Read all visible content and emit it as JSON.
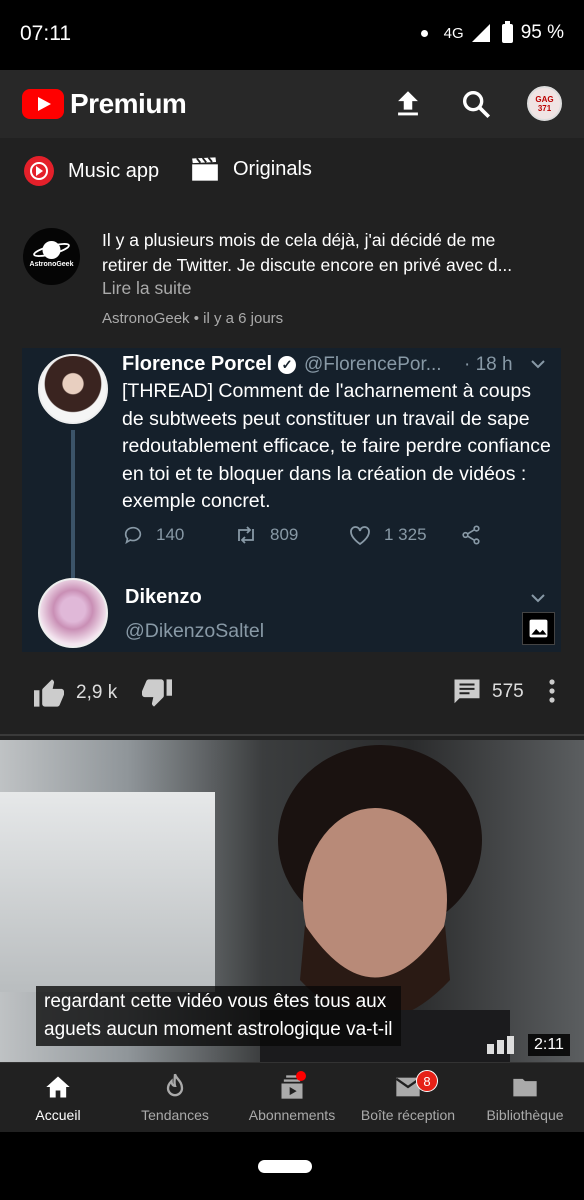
{
  "status": {
    "time": "07:11",
    "network": "4G",
    "battery": "95 %"
  },
  "app_bar": {
    "brand": "Premium",
    "avatar_text": "GAG 371"
  },
  "chips": [
    {
      "label": "Music app"
    },
    {
      "label": "Originals"
    }
  ],
  "post": {
    "avatar_label": "AstronoGeek",
    "text_lines": [
      "Il y a plusieurs mois de cela déjà, j'ai décidé de me",
      "retirer de Twitter. Je discute encore en privé avec d..."
    ],
    "read_more": "Lire la suite",
    "meta": "AstronoGeek • il y a 6 jours"
  },
  "tweet": {
    "name": "Florence Porcel",
    "handle": "@FlorencePor...",
    "time": "· 18 h",
    "body": "[THREAD] Comment de l'acharnement à coups de subtweets peut constituer un travail de sape redoutablement efficace, te faire perdre confiance en toi et te bloquer dans la création de vidéos : exemple concret.",
    "replies": "140",
    "retweets": "809",
    "likes": "1 325",
    "second_name": "Dikenzo",
    "second_handle": "@DikenzoSaltel"
  },
  "post_actions": {
    "likes": "2,9 k",
    "comments": "575"
  },
  "video": {
    "caption_line1": "regardant cette vidéo vous êtes tous aux",
    "caption_line2": "aguets aucun moment astrologique va-t-il",
    "duration": "2:11"
  },
  "bottom_nav": [
    {
      "label": "Accueil",
      "icon": "home-icon"
    },
    {
      "label": "Tendances",
      "icon": "flame-icon"
    },
    {
      "label": "Abonnements",
      "icon": "subscriptions-icon"
    },
    {
      "label": "Boîte réception",
      "icon": "mail-icon",
      "badge": "8"
    },
    {
      "label": "Bibliothèque",
      "icon": "folder-icon"
    }
  ],
  "colors": {
    "brand_red": "#ff0000",
    "tweet_bg": "#15202b",
    "feed_bg": "#212121"
  }
}
